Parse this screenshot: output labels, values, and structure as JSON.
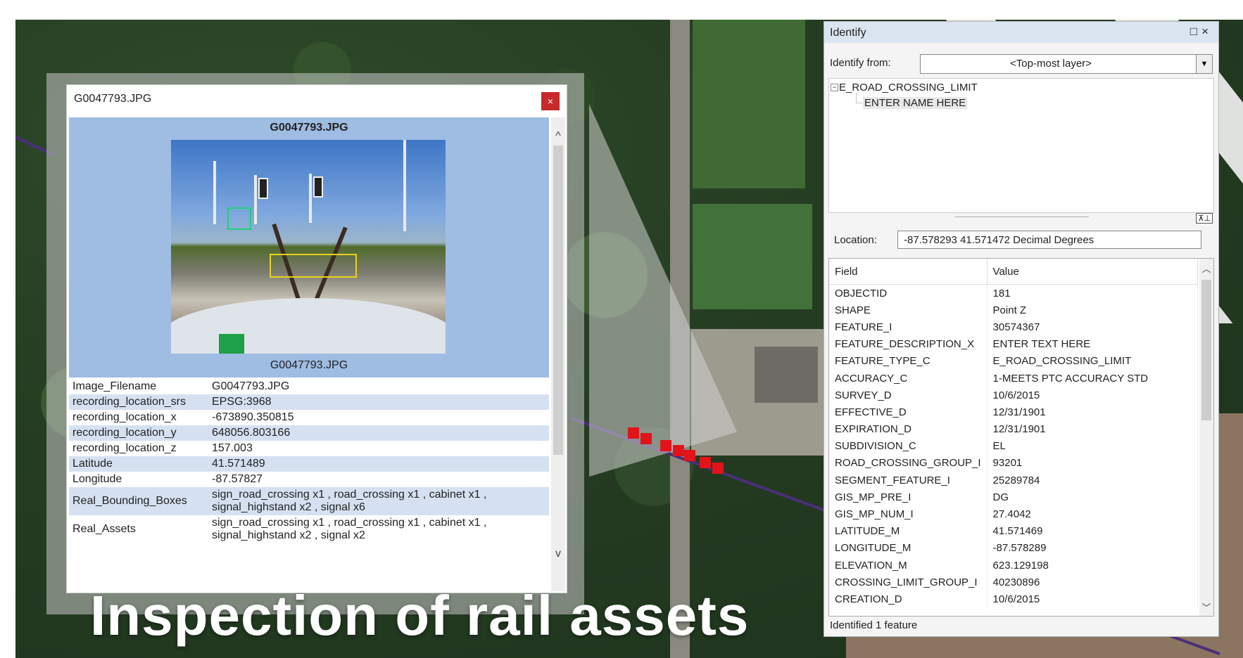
{
  "headline": "Inspection of rail assets",
  "colors": {
    "marker": "#e0141a",
    "track": "#4a2f7a",
    "popup_header_bg": "#9fbce3",
    "close_button": "#c62a2a",
    "row_alt": "#d5e1f1"
  },
  "popup": {
    "window_title": "G0047793.JPG",
    "close_label": "×",
    "image_title": "G0047793.JPG",
    "image_caption": "G0047793.JPG",
    "scroll_up": "^",
    "scroll_down": "v",
    "attributes": [
      {
        "key": "Image_Filename",
        "value": "G0047793.JPG"
      },
      {
        "key": "recording_location_srs",
        "value": "EPSG:3968"
      },
      {
        "key": "recording_location_x",
        "value": "-673890.350815"
      },
      {
        "key": "recording_location_y",
        "value": "648056.803166"
      },
      {
        "key": "recording_location_z",
        "value": "157.003"
      },
      {
        "key": "Latitude",
        "value": "41.571489"
      },
      {
        "key": "Longitude",
        "value": "-87.57827"
      },
      {
        "key": "Real_Bounding_Boxes",
        "value": "sign_road_crossing x1 , road_crossing x1 , cabinet x1 , signal_highstand x2 , signal x6"
      },
      {
        "key": "Real_Assets",
        "value": "sign_road_crossing x1 , road_crossing x1 , cabinet x1 , signal_highstand x2 , signal x2"
      }
    ]
  },
  "identify": {
    "title": "Identify",
    "window_buttons": "□×",
    "from_label": "Identify from:",
    "from_value": "<Top-most layer>",
    "tree_root": "E_ROAD_CROSSING_LIMIT",
    "tree_child": "ENTER NAME HERE",
    "location_label": "Location:",
    "location_value": "-87.578293  41.571472 Decimal Degrees",
    "col_field": "Field",
    "col_value": "Value",
    "rows": [
      {
        "field": "OBJECTID",
        "value": "181"
      },
      {
        "field": "SHAPE",
        "value": "Point Z"
      },
      {
        "field": "FEATURE_I",
        "value": "30574367"
      },
      {
        "field": "FEATURE_DESCRIPTION_X",
        "value": "ENTER TEXT HERE"
      },
      {
        "field": "FEATURE_TYPE_C",
        "value": "E_ROAD_CROSSING_LIMIT"
      },
      {
        "field": "ACCURACY_C",
        "value": "1-MEETS PTC ACCURACY STD"
      },
      {
        "field": "SURVEY_D",
        "value": "10/6/2015"
      },
      {
        "field": "EFFECTIVE_D",
        "value": "12/31/1901"
      },
      {
        "field": "EXPIRATION_D",
        "value": "12/31/1901"
      },
      {
        "field": "SUBDIVISION_C",
        "value": "EL"
      },
      {
        "field": "ROAD_CROSSING_GROUP_I",
        "value": "93201"
      },
      {
        "field": "SEGMENT_FEATURE_I",
        "value": "25289784"
      },
      {
        "field": "GIS_MP_PRE_I",
        "value": "DG"
      },
      {
        "field": "GIS_MP_NUM_I",
        "value": "27.4042"
      },
      {
        "field": "LATITUDE_M",
        "value": "41.571469"
      },
      {
        "field": "LONGITUDE_M",
        "value": "-87.578289"
      },
      {
        "field": "ELEVATION_M",
        "value": "623.129198"
      },
      {
        "field": "CROSSING_LIMIT_GROUP_I",
        "value": "40230896"
      },
      {
        "field": "CREATION_D",
        "value": "10/6/2015"
      }
    ],
    "status": "Identified 1 feature"
  }
}
